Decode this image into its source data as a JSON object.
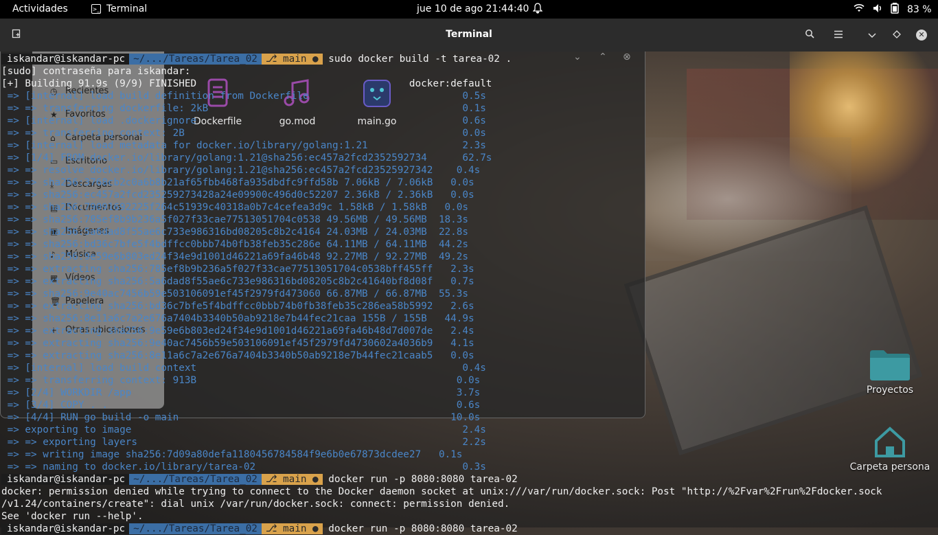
{
  "topbar": {
    "activities": "Actividades",
    "app_name": "Terminal",
    "clock": "jue 10 de ago  21:44:40",
    "battery": "83 %"
  },
  "window": {
    "title": "Terminal"
  },
  "terminal": {
    "prompt": {
      "user": "iskandar@iskandar-pc",
      "path": "~/.../Tareas/Tarea_02",
      "branch": "main"
    },
    "command1": "sudo docker build -t tarea-02 .",
    "lines": [
      {
        "text": "[sudo] contraseña para iskandar:",
        "cls": ""
      },
      {
        "text": "[+] Building 91.9s (9/9) FINISHED                                    docker:default",
        "cls": ""
      },
      {
        "text": " => [internal] load build definition from Dockerfile                          0.5s",
        "cls": "blue"
      },
      {
        "text": " => => transferring dockerfile: 2kB                                           0.1s",
        "cls": "blue"
      },
      {
        "text": " => [internal] load .dockerignore                                             0.6s",
        "cls": "blue"
      },
      {
        "text": " => => transferring context: 2B                                               0.0s",
        "cls": "blue"
      },
      {
        "text": " => [internal] load metadata for docker.io/library/golang:1.21                2.3s",
        "cls": "blue"
      },
      {
        "text": " => [1/4] FROM docker.io/library/golang:1.21@sha256:ec457a2fcd2352592734      62.7s",
        "cls": "blue"
      },
      {
        "text": " => => resolve docker.io/library/golang:1.21@sha256:ec457a2fcd23525927342    0.4s",
        "cls": "blue"
      },
      {
        "text": " => => sha256:3768cb2c0a6b8b21af65fbb468fa935dbdfc9ffd58b 7.06kB / 7.06kB   0.0s",
        "cls": "blue"
      },
      {
        "text": " => => sha256:ec457a2fcd235259273428a24e09900c496d0c52207 2.36kB / 2.36kB   0.0s",
        "cls": "blue"
      },
      {
        "text": " => => sha256:79091692225f264c51939c40318a0b7c4cefea3d9c 1.58kB / 1.58kB   0.0s",
        "cls": "blue"
      },
      {
        "text": " => => sha256:785ef8b9b236a5f027f33cae77513051704c0538 49.56MB / 49.56MB  18.3s",
        "cls": "blue"
      },
      {
        "text": " => => sha256:5a6dad8f55ae6c733e986316bd08205c8b2c4164 24.03MB / 24.03MB  22.8s",
        "cls": "blue"
      },
      {
        "text": " => => sha256:bd36c7bfe5f4bdffcc0bbb74b0fb38feb35c286e 64.11MB / 64.11MB  44.2s",
        "cls": "blue"
      },
      {
        "text": " => => sha256:9e59e6b803ed24f34e9d1001d46221a69fa46b48 92.27MB / 92.27MB  49.2s",
        "cls": "blue"
      },
      {
        "text": " => => extracting sha256:785ef8b9b236a5f027f33cae77513051704c0538bff455ff   2.3s",
        "cls": "blue"
      },
      {
        "text": " => => extracting sha256:5a6dad8f55ae6c733e986316bd08205c8b2c41640bf8d08f   0.7s",
        "cls": "blue"
      },
      {
        "text": " => => sha256:9e40ac7456b59e503106091ef45f2979fd473060 66.87MB / 66.87MB  55.3s",
        "cls": "blue"
      },
      {
        "text": " => => extracting sha256:bd36c7bfe5f4bdffcc0bbb74b0fb38feb35c286ea58b5992   2.6s",
        "cls": "blue"
      },
      {
        "text": " => => sha256:8e11a6c7a2e676a7404b3340b50ab9218e7b44fec21caa 155B / 155B   44.9s",
        "cls": "blue"
      },
      {
        "text": " => => extracting sha256:9e59e6b803ed24f34e9d1001d46221a69fa46b48d7d007de   2.4s",
        "cls": "blue"
      },
      {
        "text": " => => extracting sha256:9e40ac7456b59e503106091ef45f2979fd4730602a4036b9   4.1s",
        "cls": "blue"
      },
      {
        "text": " => => extracting sha256:8e11a6c7a2e676a7404b3340b50ab9218e7b44fec21caab5   0.0s",
        "cls": "blue"
      },
      {
        "text": " => [internal] load build context                                             0.4s",
        "cls": "blue"
      },
      {
        "text": " => => transferring context: 913B                                            0.0s",
        "cls": "blue"
      },
      {
        "text": " => [2/4] WORKDIR /app                                                       3.7s",
        "cls": "blue"
      },
      {
        "text": " => [3/4] COPY . .                                                           0.6s",
        "cls": "blue"
      },
      {
        "text": " => [4/4] RUN go build -o main                                              10.0s",
        "cls": "blue"
      },
      {
        "text": " => exporting to image                                                        2.4s",
        "cls": "blue"
      },
      {
        "text": " => => exporting layers                                                       2.2s",
        "cls": "blue"
      },
      {
        "text": " => => writing image sha256:7d09a80defa1180456784584f9e6b0e67873dcdee27   0.1s",
        "cls": "blue"
      },
      {
        "text": " => => naming to docker.io/library/tarea-02                                   0.3s",
        "cls": "blue"
      }
    ],
    "command2": "docker run -p 8080:8080 tarea-02",
    "error_lines": [
      "docker: permission denied while trying to connect to the Docker daemon socket at unix:///var/run/docker.sock: Post \"http://%2Fvar%2Frun%2Fdocker.sock",
      "/v1.24/containers/create\": dial unix /var/run/docker.sock: connect: permission denied.",
      "See 'docker run --help'."
    ]
  },
  "file_manager": {
    "sidebar": [
      {
        "label": "Recientes",
        "icon": "clock-icon"
      },
      {
        "label": "Favoritos",
        "icon": "star-icon"
      },
      {
        "label": "Carpeta personal",
        "icon": "home-icon"
      },
      {
        "label": "Escritorio",
        "icon": "desktop-icon"
      },
      {
        "label": "Descargas",
        "icon": "download-icon"
      },
      {
        "label": "Documentos",
        "icon": "document-icon"
      },
      {
        "label": "Imágenes",
        "icon": "image-icon"
      },
      {
        "label": "Música",
        "icon": "music-icon"
      },
      {
        "label": "Vídeos",
        "icon": "video-icon"
      },
      {
        "label": "Papelera",
        "icon": "trash-icon"
      },
      {
        "label": "Otras ubicaciones",
        "icon": "plus-icon"
      }
    ],
    "files": [
      {
        "name": "Dockerfile"
      },
      {
        "name": "go.mod"
      },
      {
        "name": "main.go"
      }
    ]
  },
  "desktop": {
    "icons": [
      {
        "label": "Proyectos"
      },
      {
        "label": "Carpeta persona"
      }
    ]
  },
  "colors": {
    "prompt_path_bg": "#3b6ea5",
    "prompt_git_bg": "#d9a24b",
    "log_blue": "#4a86c8",
    "header_bg": "#2c2c2c"
  }
}
